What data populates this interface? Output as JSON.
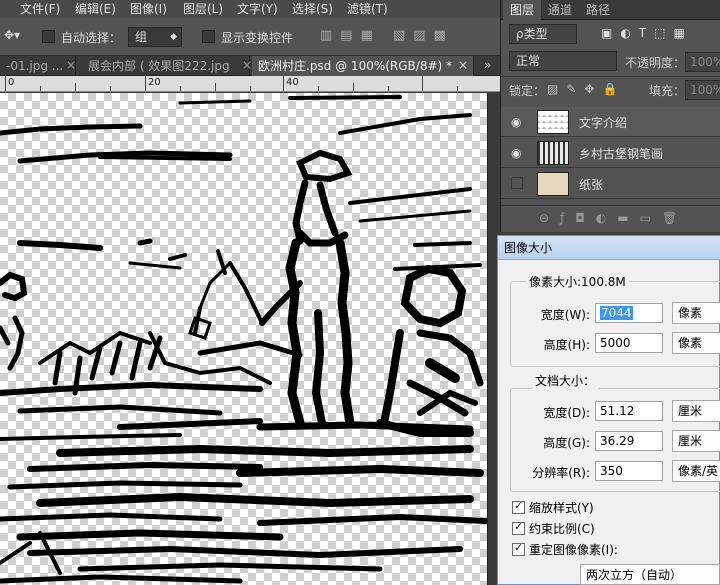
{
  "menu": [
    "文件(F)",
    "编辑(E)",
    "图像(I)",
    "图层(L)",
    "文字(Y)",
    "选择(S)",
    "滤镜(T)"
  ],
  "options": {
    "auto_select_label": "自动选择：",
    "auto_select_value": "组",
    "show_transform_label": "显示变换控件"
  },
  "tabs": [
    {
      "label": "-01.jpg ...",
      "close": "×"
    },
    {
      "label": "展会内部 ( 效果图222.jpg",
      "close": "×"
    },
    {
      "label": "欧洲村庄.psd @ 100%(RGB/8#) *",
      "close": "×"
    }
  ],
  "tab_overflow": "»",
  "ruler": {
    "labels": [
      "0",
      "20",
      "40"
    ]
  },
  "layers_panel": {
    "tabs": [
      "图层",
      "通道",
      "路径"
    ],
    "filter_label": "ρ类型",
    "blend_mode": "正常",
    "opacity_label": "不透明度：",
    "opacity_value": "100%",
    "lock_label": "锁定：",
    "fill_label": "填充：",
    "fill_value": "100%",
    "layers": [
      {
        "name": "文字介绍",
        "visible": true
      },
      {
        "name": "乡村古堡钢笔画",
        "visible": true
      },
      {
        "name": "纸张",
        "visible": false
      }
    ]
  },
  "dialog": {
    "title": "图像大小",
    "pixel_group_label": "像素大小:100.8M",
    "width_label": "宽度(W):",
    "width_value": "7044",
    "width_unit": "像素",
    "height_label": "高度(H):",
    "height_value": "5000",
    "height_unit": "像素",
    "doc_group_label": "文档大小：",
    "doc_width_label": "宽度(D):",
    "doc_width_value": "51.12",
    "doc_width_unit": "厘米",
    "doc_height_label": "高度(G):",
    "doc_height_value": "36.29",
    "doc_height_unit": "厘米",
    "resolution_label": "分辨率(R):",
    "resolution_value": "350",
    "resolution_unit": "像素/英",
    "scale_styles_label": "缩放样式(Y)",
    "constrain_label": "约束比例(C)",
    "resample_label": "重定图像像素(I):",
    "resample_method": "两次立方（自动）"
  }
}
